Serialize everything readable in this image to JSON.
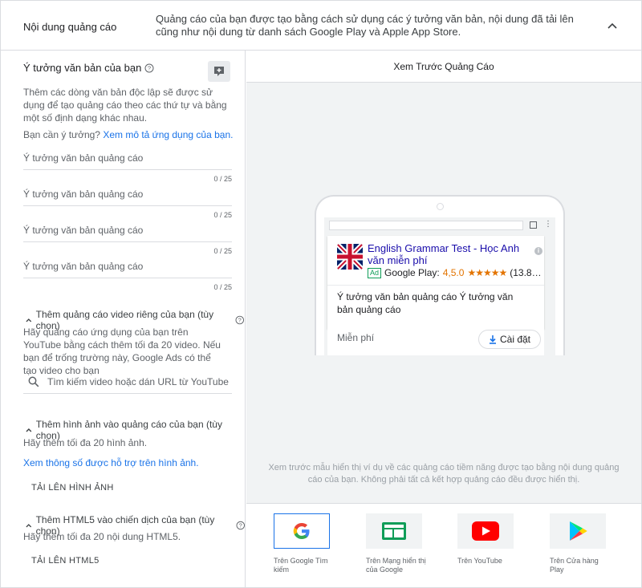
{
  "header": {
    "title": "Nội dung quảng cáo",
    "description": "Quảng cáo của bạn được tạo bằng cách sử dụng các ý tưởng văn bản, nội dung đã tải lên cũng như nội dung từ danh sách Google Play và Apple App Store."
  },
  "text_ideas": {
    "title": "Ý tưởng văn bản của bạn",
    "description": "Thêm các dòng văn bản độc lập sẽ được sử dụng để tạo quảng cáo theo các thứ tự và bằng một số định dạng khác nhau.",
    "need_ideas": "Bạn cần ý tưởng?",
    "see_app_desc": "Xem mô tả ứng dụng của bạn.",
    "fields": [
      {
        "placeholder": "Ý tưởng văn bản quảng cáo",
        "counter": "0 / 25"
      },
      {
        "placeholder": "Ý tưởng văn bản quảng cáo",
        "counter": "0 / 25"
      },
      {
        "placeholder": "Ý tưởng văn bản quảng cáo",
        "counter": "0 / 25"
      },
      {
        "placeholder": "Ý tưởng văn bản quảng cáo",
        "counter": "0 / 25"
      }
    ]
  },
  "video": {
    "title": "Thêm quảng cáo video riêng của bạn (tùy chọn)",
    "description": "Hãy quảng cáo ứng dụng của bạn trên YouTube bằng cách thêm tối đa 20 video. Nếu bạn để trống trường này, Google Ads có thể tạo video cho bạn",
    "search_placeholder": "Tìm kiếm video hoặc dán URL từ YouTube"
  },
  "images": {
    "title": "Thêm hình ảnh vào quảng cáo của bạn (tùy chọn)",
    "description": "Hãy thêm tối đa 20 hình ảnh.",
    "specs_link": "Xem thông số được hỗ trợ trên hình ảnh.",
    "upload_label": "TẢI LÊN HÌNH ẢNH"
  },
  "html5": {
    "title": "Thêm HTML5 vào chiến dịch của bạn (tùy chọn)",
    "description": "Hãy thêm tối đa 20 nội dung HTML5.",
    "upload_label": "TẢI LÊN HTML5"
  },
  "preview": {
    "title": "Xem Trước Quảng Cáo",
    "ad": {
      "app_title": "English Grammar Test - Học Anh văn miễn phí",
      "badge": "Ad",
      "store": "Google Play:",
      "rating": "4,5.0",
      "stars": "★★★★★",
      "reviews": "(13.8…",
      "body": "Ý tưởng văn bản quảng cáo Ý tưởng văn bản quảng cáo",
      "price": "Miễn phí",
      "install_label": "Cài đặt"
    },
    "note": "Xem trước mẫu hiển thị ví dụ về các quảng cáo tiềm năng được tạo bằng nội dung quảng cáo của bạn. Không phải tất cả kết hợp quảng cáo đều được hiển thị.",
    "placements": [
      {
        "label": "Trên Google Tìm kiếm",
        "icon": "google-g-icon",
        "selected": true
      },
      {
        "label": "Trên Mạng hiển thị của Google",
        "icon": "display-network-icon",
        "selected": false
      },
      {
        "label": "Trên YouTube",
        "icon": "youtube-icon",
        "selected": false
      },
      {
        "label": "Trên Cửa hàng Play",
        "icon": "google-play-icon",
        "selected": false
      }
    ]
  },
  "colors": {
    "accent": "#1a73e8",
    "link": "#1a0dab",
    "rating": "#e37400",
    "ad_badge": "#0f9d58"
  }
}
